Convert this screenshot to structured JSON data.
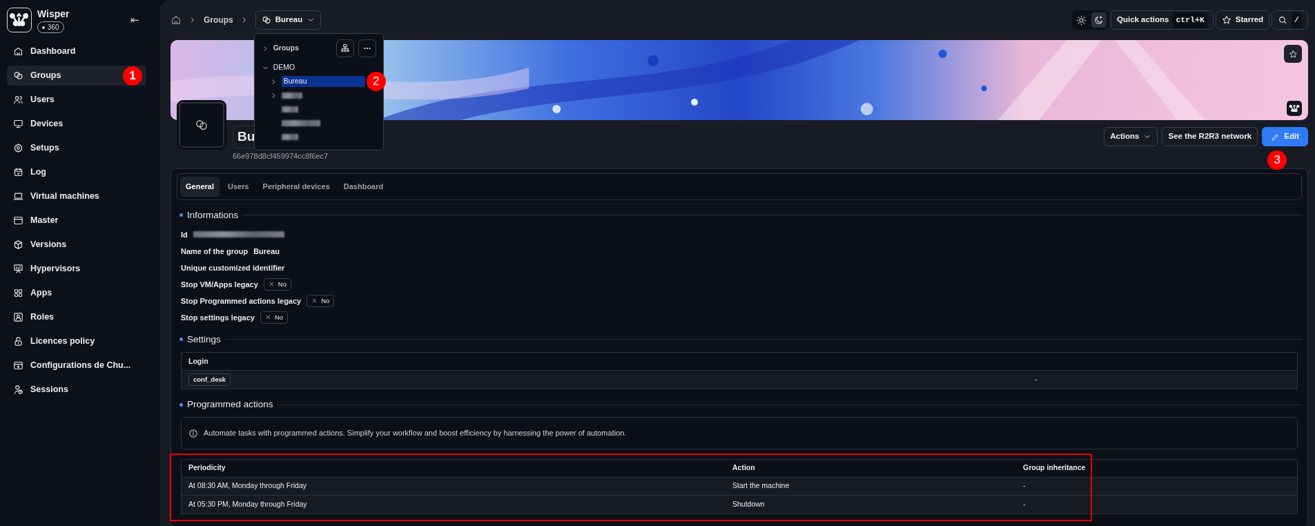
{
  "sidebar": {
    "brand": "Wisper",
    "badge": "360",
    "collapse_label": "⇤",
    "items": [
      {
        "label": "Dashboard",
        "selected": false
      },
      {
        "label": "Groups",
        "selected": true,
        "annotation": "1"
      },
      {
        "label": "Users",
        "selected": false
      },
      {
        "label": "Devices",
        "selected": false
      },
      {
        "label": "Setups",
        "selected": false
      },
      {
        "label": "Log",
        "selected": false
      },
      {
        "label": "Virtual machines",
        "selected": false
      },
      {
        "label": "Master",
        "selected": false
      },
      {
        "label": "Versions",
        "selected": false
      },
      {
        "label": "Hypervisors",
        "selected": false
      },
      {
        "label": "Apps",
        "selected": false
      },
      {
        "label": "Roles",
        "selected": false
      },
      {
        "label": "Licences policy",
        "selected": false
      },
      {
        "label": "Configurations de Chu...",
        "selected": false
      },
      {
        "label": "Sessions",
        "selected": false
      }
    ]
  },
  "breadcrumb": {
    "items": [
      "Groups"
    ],
    "current": "Bureau"
  },
  "dropdown": {
    "header": {
      "label": "Groups",
      "expanded": false
    },
    "tree": [
      {
        "label": "DEMO",
        "expanded": true,
        "children": [
          {
            "kind": "label",
            "label": "Bureau",
            "selected": true,
            "has_children": true,
            "annotation": "2"
          },
          {
            "kind": "redacted",
            "selected": false,
            "has_children": true
          },
          {
            "kind": "redacted",
            "selected": false,
            "has_children": false
          },
          {
            "kind": "redacted",
            "selected": false,
            "has_children": false
          },
          {
            "kind": "redacted",
            "selected": false,
            "has_children": false
          }
        ]
      }
    ]
  },
  "toolbar": {
    "themes": [
      {
        "kind": "light",
        "selected": false
      },
      {
        "kind": "dark",
        "selected": true
      }
    ],
    "quick_actions": "Quick actions",
    "shortcut": "ctrl+K",
    "starred": "Starred",
    "search_key": "/"
  },
  "group": {
    "title": "Bu",
    "id": "66e978d8cf459974cc8f6ec7"
  },
  "actions": [
    {
      "kind": "dropdown",
      "label": "Actions"
    },
    {
      "kind": "outline",
      "label": "See the R2R3 network"
    },
    {
      "kind": "primary",
      "label": "Edit",
      "annotation": "3"
    }
  ],
  "tabs": [
    {
      "label": "General",
      "selected": true
    },
    {
      "label": "Users",
      "selected": false
    },
    {
      "label": "Peripheral devices",
      "selected": false
    },
    {
      "label": "Dashboard",
      "selected": false
    }
  ],
  "informations": {
    "title": "Informations",
    "fields": [
      {
        "kind": "redacted",
        "label": "Id"
      },
      {
        "kind": "text",
        "label": "Name of the group",
        "value": "Bureau"
      },
      {
        "kind": "empty",
        "label": "Unique customized identifier"
      },
      {
        "kind": "toggle",
        "label": "Stop VM/Apps legacy",
        "checked": false,
        "value": "No"
      },
      {
        "kind": "toggle",
        "label": "Stop Programmed actions legacy",
        "checked": false,
        "value": "No"
      },
      {
        "kind": "toggle",
        "label": "Stop settings legacy",
        "checked": false,
        "value": "No"
      }
    ]
  },
  "settings": {
    "title": "Settings",
    "columns": [
      "Login"
    ],
    "rows": [
      {
        "login": "conf_desk",
        "column_2": "-"
      }
    ]
  },
  "programmed_actions": {
    "title": "Programmed actions",
    "info": "Automate tasks with programmed actions. Simplify your workflow and boost efficiency by harnessing the power of automation.",
    "highlighted": true,
    "columns": [
      "Periodicity",
      "Action",
      "Group inheritance"
    ],
    "rows": [
      [
        "At 08:30 AM, Monday through Friday",
        "Start the machine",
        "-"
      ],
      [
        "At 05:30 PM, Monday through Friday",
        "Shutdown",
        "-"
      ]
    ]
  }
}
